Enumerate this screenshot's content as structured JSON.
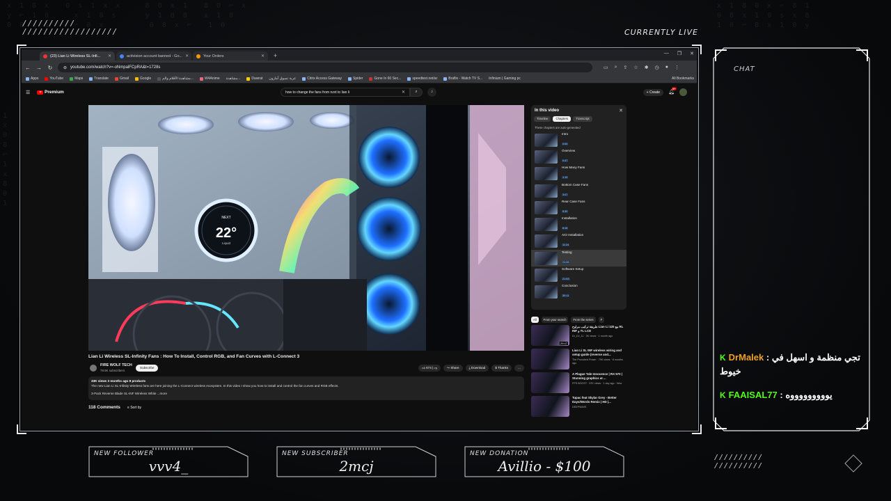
{
  "overlay": {
    "status_label": "CURRENTLY LIVE",
    "chat_label": "CHAT",
    "chat_messages": [
      {
        "user": "DrMalek",
        "text": "تجي منظمة و اسهل في خيوط"
      },
      {
        "user": "FAAISAL77",
        "text": "يوووووووووه"
      }
    ],
    "alerts": {
      "follower": {
        "label": "NEW FOLLOWER",
        "value": "vvv4_"
      },
      "subscriber": {
        "label": "NEW SUBSCRIBER",
        "value": "2mcj"
      },
      "donation": {
        "label": "NEW DONATION",
        "value": "Avillio - $100"
      }
    },
    "colors": {
      "accent_green": "#53fc18",
      "user_orange": "#f0a020"
    }
  },
  "browser": {
    "tabs": [
      {
        "label": "(23) Lian Li Wireless SL-Infi...",
        "active": true
      },
      {
        "label": "activision account banned - Go..."
      },
      {
        "label": "Your Orders"
      }
    ],
    "url": "youtube.com/watch?v=-oNmpalFCpRA&t=1728s",
    "bookmarks": [
      "Apps",
      "YouTube",
      "Maps",
      "Translate",
      "Gmail",
      "Google",
      "مشاهدة الأفلام والم...",
      "W4Anime",
      "مشاهدة...",
      "Dawrat",
      "عربة تسوق أمازون",
      "Citrix Access Gateway",
      "Spider",
      "Gone In 60 Sec...",
      "speedtest.net/ar",
      "Braflix - Watch TV S...",
      "Infinium | Gaming pc"
    ],
    "all_bookmarks": "All Bookmarks"
  },
  "youtube": {
    "logo": "Premium",
    "search_query": "how to change the fans from nzxt to lian li",
    "create_label": "Create",
    "notif_count": "9+",
    "video_title": "Lian Li Wireless SL-Infinity Fans : How To Install, Control RGB, and Fan Curves with L-Connect 3",
    "channel": {
      "name": "FIRE WOLF TECH",
      "subs": "78.6K subscribers",
      "subscribe_label": "Subscribe"
    },
    "actions": [
      "674",
      "Share",
      "Download",
      "Thanks",
      "..."
    ],
    "description": {
      "meta": "33K views  3 months ago  8 products",
      "line1": "The new Lian Li SL-Infinity Wireless fans are here joining the L-Connect wireless ecosystem. In this video I show you how to install and control the fan curves and RGB effects.",
      "line2": "3-Pack Reverse Blade SL-INF Wireless White ...more"
    },
    "comments_label": "118 Comments",
    "sort_label": "Sort by",
    "player_overlay": {
      "temp": "22°",
      "label": "NEXT",
      "sub": "Liquid"
    },
    "panel": {
      "title": "In this video",
      "tabs": [
        "Timeline",
        "Chapters",
        "Transcript"
      ],
      "note": "These chapters are auto-generated",
      "chapters": [
        {
          "title": "Intro",
          "time": "0:00"
        },
        {
          "title": "Overview",
          "time": "0:47"
        },
        {
          "title": "How Many Fans",
          "time": "1:15"
        },
        {
          "title": "Bottom Case Fans",
          "time": "3:07"
        },
        {
          "title": "Rear Case Fans",
          "time": "5:30"
        },
        {
          "title": "Installation",
          "time": "8:18"
        },
        {
          "title": "AIO Installation",
          "time": "11:24"
        },
        {
          "title": "Testing",
          "time": "21:06",
          "active": true
        },
        {
          "title": "Software Setup",
          "time": "21:53"
        },
        {
          "title": "Conclusion",
          "time": "30:11"
        }
      ]
    },
    "chips": [
      "All",
      "From your search",
      "From the series",
      "F"
    ],
    "recommended": [
      {
        "title": "طريقة تركيب مراوح Lian Li مع 120 RL INF و TL LCD",
        "meta": "Dr_DJ_11 · 3K views · 1 month ago",
        "duration": "29:47"
      },
      {
        "title": "Lian Li SL INF wireless wiring and setup guide (reverse and...",
        "meta": "The Provoked Prawn · 79K views · 8 months ago",
        "duration": ""
      },
      {
        "title": "A Plague Tale Innocence | RX 570 | Stunning graphics at ...",
        "meta": "FPS BOOST · 57K views · 1 day ago · New",
        "duration": ""
      },
      {
        "title": "Tupac feat Skylar Grey - Better Days/Words Remix | HD |...",
        "meta": "DEEPWAVE",
        "duration": ""
      }
    ]
  }
}
